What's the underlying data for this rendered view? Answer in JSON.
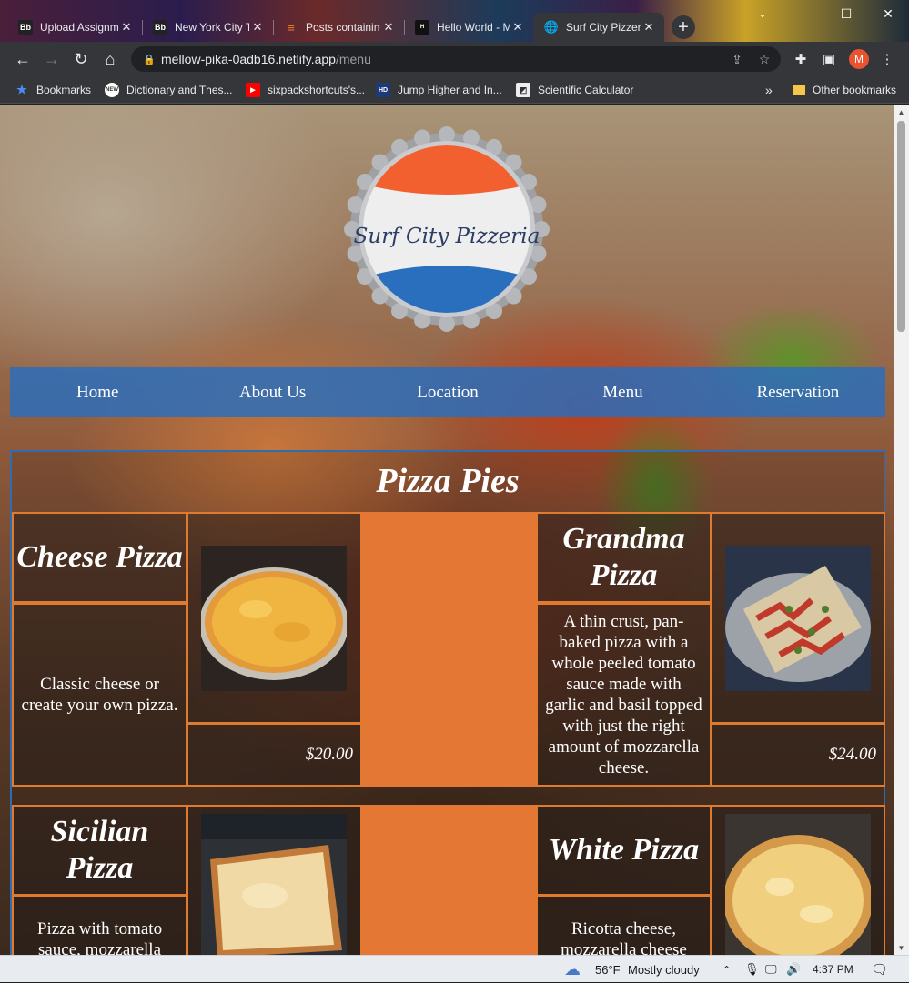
{
  "browser": {
    "tabs": [
      {
        "label": "Upload Assignm",
        "icon": "Bb"
      },
      {
        "label": "New York City T",
        "icon": "Bb"
      },
      {
        "label": "Posts containing",
        "icon": "stack"
      },
      {
        "label": "Hello World - M",
        "icon": "happy"
      },
      {
        "label": "Surf City Pizzer",
        "icon": "globe"
      }
    ],
    "url_host": "mellow-pika-0adb16.netlify.app",
    "url_path": "/menu",
    "avatar_letter": "M",
    "bookmarks": [
      {
        "label": "Bookmarks"
      },
      {
        "label": "Dictionary and Thes..."
      },
      {
        "label": "sixpackshortcuts's..."
      },
      {
        "label": "Jump Higher and In..."
      },
      {
        "label": "Scientific Calculator"
      }
    ],
    "bookmarks_overflow": "»",
    "other_bookmarks": "Other bookmarks"
  },
  "site": {
    "logo_text": "Surf City Pizzeria",
    "nav": [
      "Home",
      "About Us",
      "Location",
      "Menu",
      "Reservation"
    ],
    "menu_title": "Pizza Pies",
    "items": [
      {
        "name": "Cheese Pizza",
        "desc": "Classic cheese or create your own pizza.",
        "price": "$20.00"
      },
      {
        "name": "Grandma Pizza",
        "desc": "A thin crust, pan-baked pizza with a whole peeled tomato sauce made with garlic and basil topped with just the right amount of mozzarella cheese.",
        "price": "$24.00"
      },
      {
        "name": "Sicilian Pizza",
        "desc": "Pizza with tomato sauce, mozzarella"
      },
      {
        "name": "White Pizza",
        "desc": "Ricotta cheese, mozzarella cheese"
      }
    ]
  },
  "taskbar": {
    "weather_temp": "56°F",
    "weather_desc": "Mostly cloudy",
    "time": "4:37 PM"
  },
  "colors": {
    "nav_bg": "#2f6db0",
    "accent_orange": "#e47733",
    "logo_red": "#f2602f",
    "logo_blue": "#2a6fbd"
  }
}
